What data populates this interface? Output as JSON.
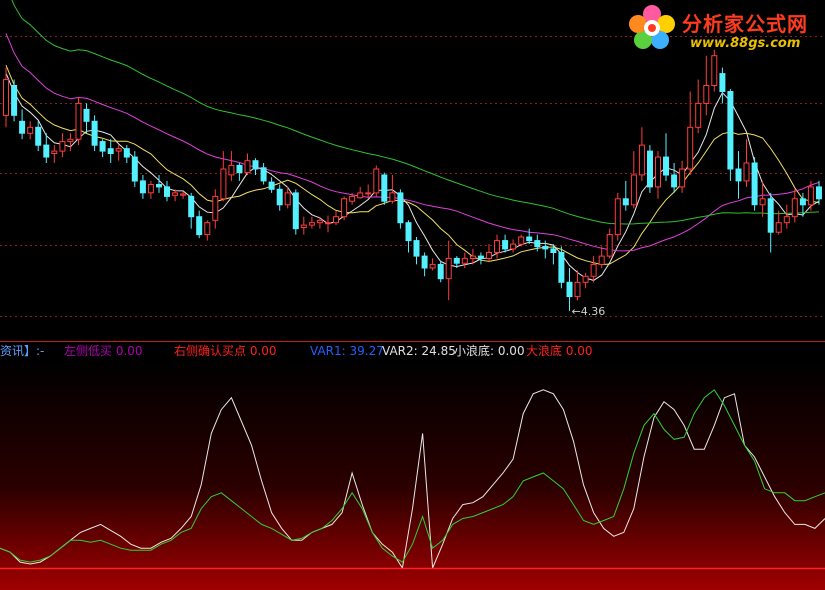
{
  "brand": {
    "title": "分析家公式网",
    "url": "www.88gs.com"
  },
  "price_annotation": "←4.36",
  "indicator_legend": [
    {
      "text": "资讯】:-",
      "color": "#5aa0ff"
    },
    {
      "text": "左侧低买  0.00",
      "color": "#b000b0"
    },
    {
      "text": "右侧确认买点  0.00",
      "color": "#ff2020"
    },
    {
      "text": "VAR1: 39.27",
      "color": "#2060ff"
    },
    {
      "text": "VAR2: 24.85",
      "color": "#e0e0e0"
    },
    {
      "text": "小浪底: 0.00",
      "color": "#e0e0e0"
    },
    {
      "text": "大浪底  0.00",
      "color": "#ff2020"
    }
  ],
  "colors": {
    "up": "#ff3c3c",
    "down": "#54f0ff",
    "ma_short": "#e8e8e8",
    "ma_mid": "#f0e060",
    "ma_long": "#e040e0",
    "ma_longest": "#30c030",
    "grid": "#8a2020",
    "var1": "#e8e8e8",
    "var2": "#30d030",
    "baseline": "#ff2020"
  },
  "chart_data": [
    {
      "type": "candlestick",
      "ylim": [
        4.2,
        6.9
      ],
      "low_marker": 4.36,
      "candles": [
        [
          6.0,
          6.3,
          6.4,
          5.9
        ],
        [
          6.25,
          6.0,
          6.3,
          5.95
        ],
        [
          5.95,
          5.85,
          6.05,
          5.8
        ],
        [
          5.85,
          5.9,
          5.95,
          5.8
        ],
        [
          5.9,
          5.75,
          5.95,
          5.7
        ],
        [
          5.75,
          5.65,
          5.85,
          5.6
        ],
        [
          5.68,
          5.7,
          5.75,
          5.6
        ],
        [
          5.7,
          5.78,
          5.85,
          5.65
        ],
        [
          5.78,
          5.8,
          5.85,
          5.7
        ],
        [
          5.8,
          6.1,
          6.15,
          5.75
        ],
        [
          6.05,
          5.95,
          6.1,
          5.85
        ],
        [
          5.95,
          5.75,
          6.0,
          5.7
        ],
        [
          5.78,
          5.7,
          5.8,
          5.65
        ],
        [
          5.72,
          5.68,
          5.8,
          5.6
        ],
        [
          5.7,
          5.72,
          5.75,
          5.62
        ],
        [
          5.72,
          5.65,
          5.75,
          5.6
        ],
        [
          5.65,
          5.45,
          5.7,
          5.4
        ],
        [
          5.45,
          5.35,
          5.5,
          5.3
        ],
        [
          5.35,
          5.42,
          5.45,
          5.3
        ],
        [
          5.42,
          5.4,
          5.5,
          5.35
        ],
        [
          5.4,
          5.32,
          5.45,
          5.28
        ],
        [
          5.33,
          5.35,
          5.38,
          5.28
        ],
        [
          5.33,
          5.34,
          5.36,
          5.3
        ],
        [
          5.32,
          5.15,
          5.35,
          5.05
        ],
        [
          5.15,
          5.0,
          5.2,
          4.97
        ],
        [
          5.0,
          5.1,
          5.12,
          4.95
        ],
        [
          5.12,
          5.32,
          5.38,
          5.05
        ],
        [
          5.3,
          5.55,
          5.7,
          5.28
        ],
        [
          5.5,
          5.58,
          5.7,
          5.45
        ],
        [
          5.58,
          5.52,
          5.6,
          5.45
        ],
        [
          5.52,
          5.62,
          5.68,
          5.5
        ],
        [
          5.62,
          5.55,
          5.64,
          5.5
        ],
        [
          5.56,
          5.45,
          5.6,
          5.42
        ],
        [
          5.44,
          5.38,
          5.48,
          5.35
        ],
        [
          5.38,
          5.25,
          5.42,
          5.2
        ],
        [
          5.25,
          5.35,
          5.4,
          5.22
        ],
        [
          5.35,
          5.05,
          5.38,
          5.0
        ],
        [
          5.06,
          5.08,
          5.15,
          5.0
        ],
        [
          5.08,
          5.1,
          5.15,
          5.05
        ],
        [
          5.1,
          5.12,
          5.15,
          5.05
        ],
        [
          5.1,
          5.1,
          5.16,
          5.02
        ],
        [
          5.1,
          5.15,
          5.2,
          5.08
        ],
        [
          5.15,
          5.3,
          5.32,
          5.12
        ],
        [
          5.28,
          5.32,
          5.35,
          5.25
        ],
        [
          5.31,
          5.35,
          5.4,
          5.3
        ],
        [
          5.35,
          5.35,
          5.42,
          5.3
        ],
        [
          5.35,
          5.55,
          5.58,
          5.32
        ],
        [
          5.5,
          5.28,
          5.52,
          5.25
        ],
        [
          5.28,
          5.35,
          5.5,
          5.26
        ],
        [
          5.35,
          5.1,
          5.38,
          5.05
        ],
        [
          5.1,
          4.95,
          5.12,
          4.85
        ],
        [
          4.95,
          4.82,
          4.98,
          4.75
        ],
        [
          4.82,
          4.72,
          4.85,
          4.65
        ],
        [
          4.72,
          4.75,
          4.8,
          4.7
        ],
        [
          4.75,
          4.63,
          4.78,
          4.6
        ],
        [
          4.63,
          4.8,
          4.95,
          4.45
        ],
        [
          4.8,
          4.76,
          4.82,
          4.72
        ],
        [
          4.76,
          4.8,
          4.85,
          4.72
        ],
        [
          4.8,
          4.82,
          4.88,
          4.75
        ],
        [
          4.82,
          4.8,
          4.85,
          4.75
        ],
        [
          4.8,
          4.85,
          4.92,
          4.78
        ],
        [
          4.85,
          4.95,
          5.0,
          4.8
        ],
        [
          4.95,
          4.88,
          5.0,
          4.85
        ],
        [
          4.88,
          4.92,
          4.96,
          4.85
        ],
        [
          4.92,
          4.98,
          5.0,
          4.9
        ],
        [
          4.98,
          4.95,
          5.05,
          4.92
        ],
        [
          4.95,
          4.9,
          5.0,
          4.86
        ],
        [
          4.9,
          4.88,
          4.95,
          4.8
        ],
        [
          4.88,
          4.85,
          4.92,
          4.75
        ],
        [
          4.85,
          4.6,
          4.9,
          4.55
        ],
        [
          4.6,
          4.48,
          4.72,
          4.36
        ],
        [
          4.48,
          4.6,
          4.7,
          4.45
        ],
        [
          4.6,
          4.65,
          4.68,
          4.55
        ],
        [
          4.65,
          4.75,
          4.82,
          4.6
        ],
        [
          4.75,
          4.82,
          4.9,
          4.72
        ],
        [
          4.82,
          5.0,
          5.05,
          4.8
        ],
        [
          5.0,
          5.3,
          5.35,
          4.95
        ],
        [
          5.3,
          5.25,
          5.45,
          5.2
        ],
        [
          5.25,
          5.5,
          5.7,
          5.22
        ],
        [
          5.5,
          5.75,
          5.9,
          5.45
        ],
        [
          5.7,
          5.4,
          5.75,
          5.35
        ],
        [
          5.4,
          5.65,
          5.7,
          5.3
        ],
        [
          5.65,
          5.5,
          5.85,
          5.45
        ],
        [
          5.5,
          5.4,
          5.6,
          5.35
        ],
        [
          5.4,
          5.55,
          5.62,
          5.35
        ],
        [
          5.55,
          5.9,
          6.2,
          5.5
        ],
        [
          5.9,
          6.1,
          6.3,
          5.85
        ],
        [
          6.1,
          6.25,
          6.5,
          6.0
        ],
        [
          6.25,
          6.5,
          6.55,
          6.2
        ],
        [
          6.35,
          6.2,
          6.4,
          6.1
        ],
        [
          6.2,
          5.55,
          6.22,
          5.45
        ],
        [
          5.55,
          5.45,
          5.7,
          5.3
        ],
        [
          5.45,
          5.6,
          5.8,
          5.4
        ],
        [
          5.6,
          5.25,
          5.65,
          5.2
        ],
        [
          5.25,
          5.3,
          5.45,
          5.15
        ],
        [
          5.3,
          5.02,
          5.35,
          4.85
        ],
        [
          5.02,
          5.1,
          5.2,
          5.0
        ],
        [
          5.1,
          5.15,
          5.25,
          5.05
        ],
        [
          5.15,
          5.3,
          5.38,
          5.1
        ],
        [
          5.3,
          5.25,
          5.35,
          5.15
        ],
        [
          5.25,
          5.4,
          5.45,
          5.2
        ],
        [
          5.4,
          5.3,
          5.45,
          5.25
        ]
      ],
      "moving_averages": [
        {
          "period": 5,
          "color": "#e8e8e8"
        },
        {
          "period": 10,
          "color": "#f0e060"
        },
        {
          "period": 30,
          "color": "#e040e0"
        },
        {
          "period": 60,
          "color": "#30c030"
        }
      ]
    },
    {
      "type": "line",
      "ylim": [
        0,
        100
      ],
      "series": [
        {
          "color": "#e8e8e8",
          "values": [
            10,
            8,
            3,
            2,
            3,
            6,
            10,
            14,
            18,
            20,
            22,
            19,
            16,
            12,
            10,
            10,
            13,
            15,
            20,
            26,
            42,
            68,
            80,
            86,
            74,
            62,
            44,
            28,
            20,
            14,
            14,
            18,
            20,
            22,
            28,
            48,
            32,
            18,
            12,
            8,
            0,
            30,
            68,
            0,
            12,
            25,
            32,
            33,
            36,
            42,
            48,
            55,
            78,
            88,
            90,
            88,
            80,
            64,
            42,
            28,
            20,
            16,
            18,
            30,
            56,
            76,
            84,
            80,
            72,
            60,
            60,
            72,
            86,
            88,
            62,
            56,
            46,
            36,
            28,
            22,
            22,
            20,
            25
          ]
        },
        {
          "color": "#30d030",
          "values": [
            10,
            8,
            4,
            3,
            4,
            6,
            10,
            14,
            14,
            13,
            14,
            12,
            10,
            9,
            9,
            9,
            12,
            14,
            18,
            20,
            30,
            36,
            38,
            34,
            30,
            26,
            22,
            20,
            17,
            14,
            15,
            18,
            20,
            24,
            30,
            38,
            30,
            18,
            10,
            6,
            3,
            12,
            26,
            10,
            14,
            22,
            25,
            26,
            28,
            30,
            32,
            36,
            44,
            46,
            48,
            44,
            40,
            32,
            24,
            22,
            24,
            26,
            40,
            58,
            72,
            78,
            70,
            65,
            66,
            78,
            86,
            90,
            82,
            72,
            62,
            54,
            40,
            38,
            38,
            34,
            34,
            36,
            38
          ]
        }
      ],
      "baseline": 0
    }
  ]
}
